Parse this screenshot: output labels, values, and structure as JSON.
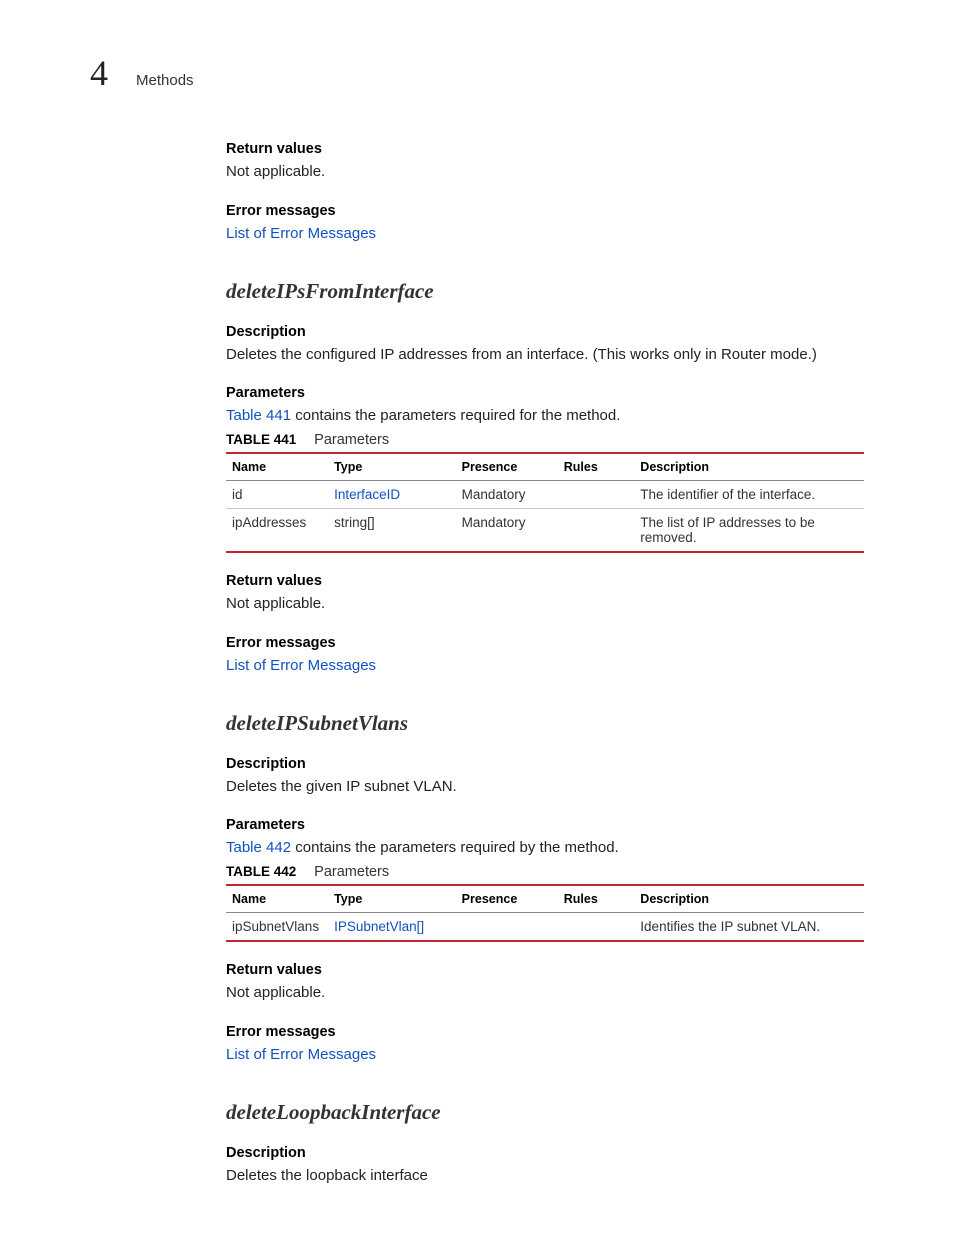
{
  "header": {
    "chapter_number": "4",
    "chapter_title": "Methods"
  },
  "sections": {
    "s0": {
      "return_values_label": "Return values",
      "return_values_text": "Not applicable.",
      "error_messages_label": "Error messages",
      "error_messages_link": "List of Error Messages"
    },
    "s1": {
      "title": "deleteIPsFromInterface",
      "description_label": "Description",
      "description_text": "Deletes the configured IP addresses from an interface. (This works only in Router mode.)",
      "parameters_label": "Parameters",
      "parameters_intro_link": "Table 441",
      "parameters_intro_rest": " contains the parameters required for the method.",
      "table_caption_label": "TABLE 441",
      "table_caption_title": "Parameters",
      "table_headers": {
        "name": "Name",
        "type": "Type",
        "presence": "Presence",
        "rules": "Rules",
        "description": "Description"
      },
      "rows": {
        "r0": {
          "name": "id",
          "type": "InterfaceID",
          "type_is_link": true,
          "presence": "Mandatory",
          "rules": "",
          "description": "The identifier of the interface."
        },
        "r1": {
          "name": "ipAddresses",
          "type": "string[]",
          "type_is_link": false,
          "presence": "Mandatory",
          "rules": "",
          "description": "The list of IP addresses to be removed."
        }
      },
      "return_values_label": "Return values",
      "return_values_text": "Not applicable.",
      "error_messages_label": "Error messages",
      "error_messages_link": "List of Error Messages"
    },
    "s2": {
      "title": "deleteIPSubnetVlans",
      "description_label": "Description",
      "description_text": "Deletes the given IP subnet VLAN.",
      "parameters_label": "Parameters",
      "parameters_intro_link": "Table 442",
      "parameters_intro_rest": " contains the parameters required by the method.",
      "table_caption_label": "TABLE 442",
      "table_caption_title": "Parameters",
      "table_headers": {
        "name": "Name",
        "type": "Type",
        "presence": "Presence",
        "rules": "Rules",
        "description": "Description"
      },
      "rows": {
        "r0": {
          "name": "ipSubnetVlans",
          "type": "IPSubnetVlan[]",
          "type_is_link": true,
          "presence": "",
          "rules": "",
          "description": "Identifies the IP subnet VLAN."
        }
      },
      "return_values_label": "Return values",
      "return_values_text": "Not applicable.",
      "error_messages_label": "Error messages",
      "error_messages_link": "List of Error Messages"
    },
    "s3": {
      "title": "deleteLoopbackInterface",
      "description_label": "Description",
      "description_text": "Deletes the loopback interface"
    }
  }
}
